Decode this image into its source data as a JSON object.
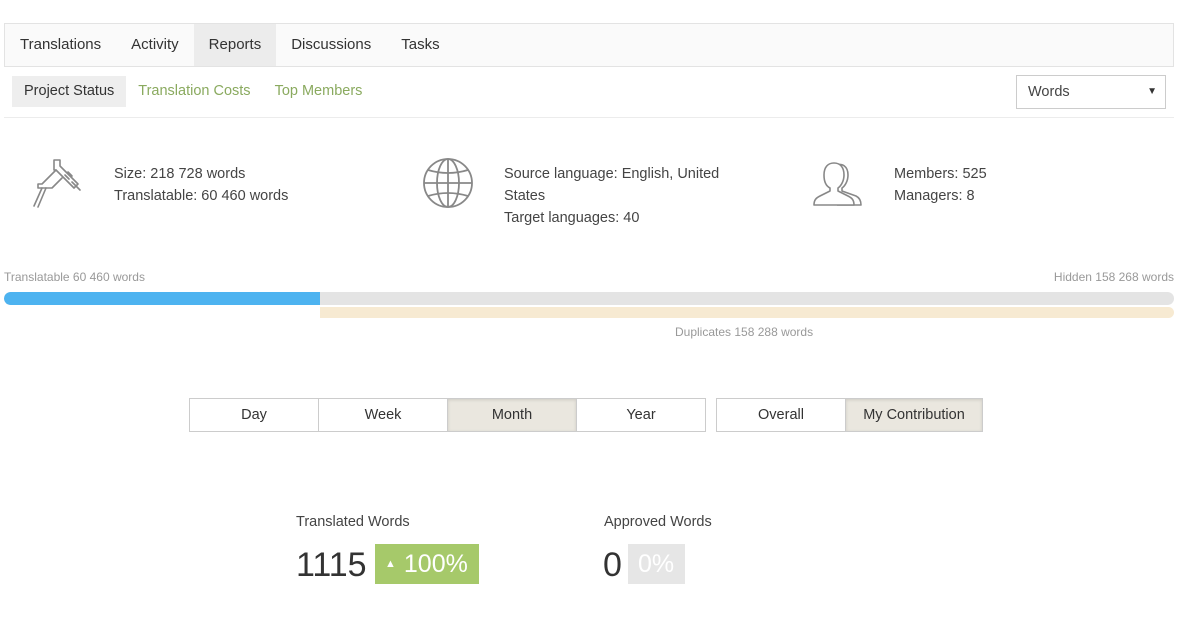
{
  "top_tabs": [
    "Translations",
    "Activity",
    "Reports",
    "Discussions",
    "Tasks"
  ],
  "sub_tabs": [
    "Project Status",
    "Translation Costs",
    "Top Members"
  ],
  "unit_select": {
    "value": "Words",
    "caret": "▼"
  },
  "stats": {
    "size": "Size: 218 728 words",
    "translatable": "Translatable: 60 460 words",
    "source_line1": "Source language: English, United",
    "source_line2": "States",
    "target": "Target languages: 40",
    "members": "Members: 525",
    "managers": "Managers: 8"
  },
  "progress": {
    "translatable_label": "Translatable 60 460 words",
    "hidden_label": "Hidden 158 268 words",
    "duplicates_label": "Duplicates 158 288 words",
    "translatable_fraction": 0.27
  },
  "period_buttons": [
    "Day",
    "Week",
    "Month",
    "Year"
  ],
  "scope_buttons": [
    "Overall",
    "My Contribution"
  ],
  "metrics": {
    "translated_label": "Translated Words",
    "translated_value": "1115",
    "translated_change": "100%",
    "translated_arrow": "▲",
    "approved_label": "Approved Words",
    "approved_value": "0",
    "approved_change": "0%"
  },
  "colors": {
    "accent_green": "#8aaa5f",
    "bar_blue": "#4db3f0",
    "badge_green": "#a6c96a"
  },
  "icons": [
    "caliper-icon",
    "globe-icon",
    "members-icon"
  ]
}
